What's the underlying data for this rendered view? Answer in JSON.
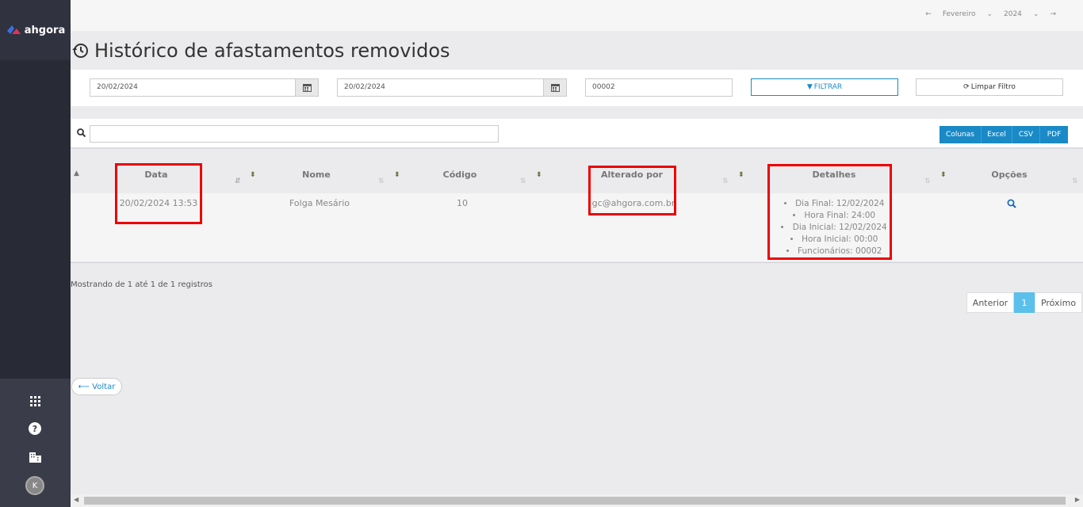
{
  "brand": {
    "logo_text": "ahgora"
  },
  "topbar": {
    "month": "Fevereiro",
    "year": "2024"
  },
  "page": {
    "title": "Histórico de afastamentos removidos"
  },
  "filters": {
    "date_start": "20/02/2024",
    "date_end": "20/02/2024",
    "code": "00002",
    "filter_label": "FILTRAR",
    "clear_label": "Limpar Filtro"
  },
  "toolbar": {
    "search_value": "",
    "exports": [
      "Colunas",
      "Excel",
      "CSV",
      "PDF"
    ]
  },
  "table": {
    "headers": [
      "Data",
      "Nome",
      "Código",
      "Alterado por",
      "Detalhes",
      "Opções"
    ],
    "rows": [
      {
        "data": "20/02/2024 13:53",
        "nome": "Folga Mesário",
        "codigo": "10",
        "alterado_por": "gc@ahgora.com.br",
        "detalhes": [
          "Dia Final: 12/02/2024",
          "Hora Final: 24:00",
          "Dia Inicial: 12/02/2024",
          "Hora Inicial: 00:00",
          "Funcionários: 00002"
        ]
      }
    ]
  },
  "footer": {
    "info": "Mostrando de 1 até 1 de 1 registros",
    "prev": "Anterior",
    "page": "1",
    "next": "Próximo",
    "back": "⟵ Voltar"
  },
  "user": {
    "initial": "K"
  },
  "colors": {
    "accent": "#1a8ac7",
    "sidebar": "#282a35",
    "highlight": "#e00000",
    "pager_active": "#5bc0eb"
  }
}
